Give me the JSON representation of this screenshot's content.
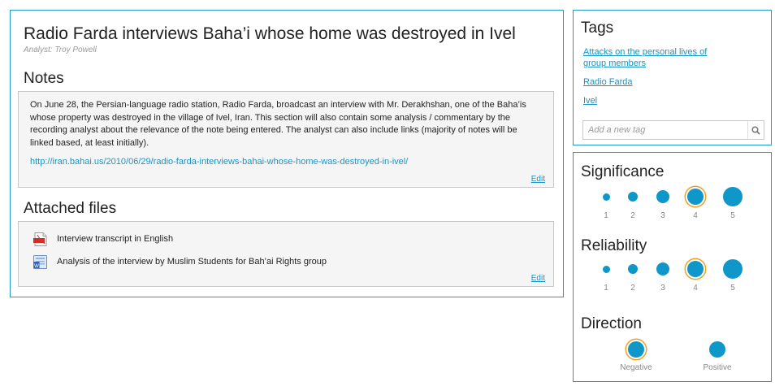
{
  "main": {
    "title": "Radio Farda interviews Baha’i whose home was destroyed in Ivel",
    "analyst": "Analyst: Troy Powell",
    "notes": {
      "heading": "Notes",
      "body": "On June 28, the Persian-language radio station, Radio Farda, broadcast an interview with Mr. Derakhshan, one of the Baha’is whose property was destroyed in the village of Ivel, Iran. This section will also contain some analysis / commentary by the recording analyst about the relevance of the note being entered. The analyst can also include links (majority of notes will be linked based, at least initially).",
      "link": "http://iran.bahai.us/2010/06/29/radio-farda-interviews-bahai-whose-home-was-destroyed-in-ivel/",
      "edit_label": "Edit"
    },
    "attached_files": {
      "heading": "Attached files",
      "files": [
        {
          "label": "Interview transcript in English",
          "icon": "pdf-file-icon"
        },
        {
          "label": "Analysis of the interview by Muslim Students for Bah’ai Rights group",
          "icon": "word-doc-icon"
        }
      ],
      "edit_label": "Edit"
    }
  },
  "tags": {
    "heading": "Tags",
    "items": [
      "Attacks on the personal lives of group members",
      "Radio Farda",
      "Ivel"
    ],
    "input_placeholder": "Add a new tag"
  },
  "ratings": {
    "significance": {
      "heading": "Significance",
      "options": [
        "1",
        "2",
        "3",
        "4",
        "5"
      ],
      "selected": "4"
    },
    "reliability": {
      "heading": "Reliability",
      "options": [
        "1",
        "2",
        "3",
        "4",
        "5"
      ],
      "selected": "4"
    },
    "direction": {
      "heading": "Direction",
      "options": [
        "Negative",
        "Positive"
      ],
      "selected": "Negative"
    }
  },
  "colors": {
    "accent": "#1e9cc9",
    "dot": "#0f97c9",
    "selected_ring": "#f0a020"
  }
}
